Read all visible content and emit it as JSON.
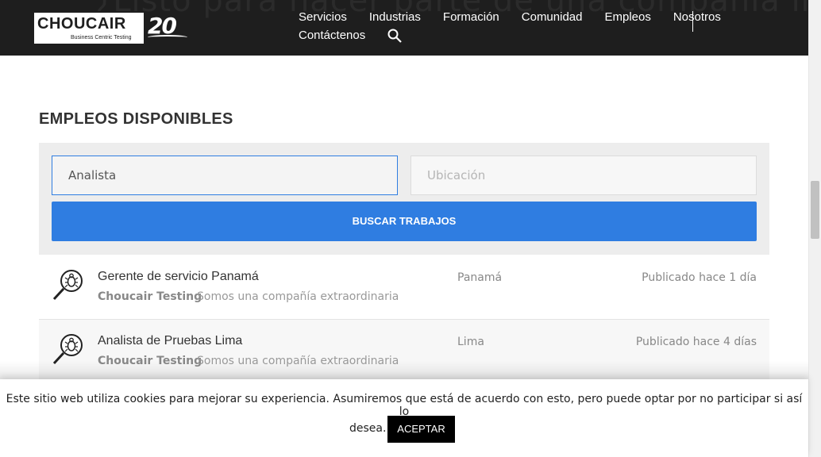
{
  "header": {
    "ghost_heading": "¿Listo para hacer parte de una compañía in ?",
    "logo": {
      "wordmark": "CHOUCAIR",
      "tagline": "Business Centric Testing",
      "anniversary": "20"
    },
    "nav": {
      "row1": [
        "Servicios",
        "Industrias",
        "Formación",
        "Comunidad",
        "Empleos",
        "Nosotros"
      ],
      "row2": [
        "Contáctenos"
      ]
    }
  },
  "main": {
    "section_title": "EMPLEOS DISPONIBLES",
    "search": {
      "keyword_value": "Analista",
      "location_placeholder": "Ubicación",
      "button_label": "BUSCAR TRABAJOS"
    },
    "jobs": [
      {
        "title": "Gerente de servicio Panamá",
        "company": "Choucair Testing",
        "tagline": "Somos una compañía extraordinaria",
        "location": "Panamá",
        "posted": "Publicado hace 1 día"
      },
      {
        "title": "Analista de Pruebas Lima",
        "company": "Choucair Testing",
        "tagline": "Somos una compañía extraordinaria",
        "location": "Lima",
        "posted": "Publicado hace 4 días"
      }
    ]
  },
  "cookie": {
    "line1": "Este sitio web utiliza cookies para mejorar su experiencia. Asumiremos que está de acuerdo con esto, pero puede optar por no participar si así lo",
    "line2": "desea.",
    "accept_label": "ACEPTAR"
  },
  "colors": {
    "header_bg": "#1e1e1e",
    "accent": "#2f7de1",
    "panel_bg": "#ededed"
  },
  "icons": [
    "search-icon",
    "bug-magnifier-icon"
  ]
}
